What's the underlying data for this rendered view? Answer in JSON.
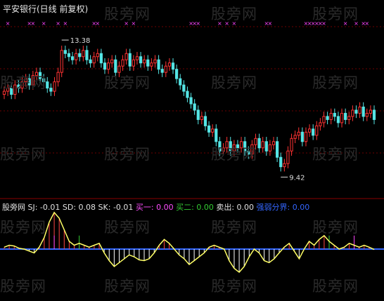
{
  "header": {
    "title": "平安银行(日线 前复权)",
    "watermark": "股旁网"
  },
  "indicator": {
    "name": "股旁网",
    "items": [
      {
        "label": "SJ:",
        "value": "-0.01",
        "color": "#e0e0e0"
      },
      {
        "label": "SD:",
        "value": "0.08",
        "color": "#e0e0e0"
      },
      {
        "label": "SK:",
        "value": "-0.01",
        "color": "#e0e0e0"
      },
      {
        "label": "买一:",
        "value": "0.00",
        "color": "#ff4dff",
        "value_color": "#ff4dff"
      },
      {
        "label": "买二:",
        "value": "0.00",
        "color": "#33cc33",
        "value_color": "#33cc33"
      },
      {
        "label": "卖出:",
        "value": "0.00",
        "color": "#e0e0e0",
        "value_color": "#e0e0e0"
      },
      {
        "label": "强弱分界:",
        "value": "0.00",
        "color": "#3366ff",
        "value_color": "#3366ff"
      }
    ]
  },
  "chart_data": [
    {
      "type": "candlestick",
      "title": "平安银行(日线 前复权)",
      "annotations": [
        {
          "text": "13.38",
          "kind": "high"
        },
        {
          "text": "9.42",
          "kind": "low"
        }
      ],
      "ylim": [
        8.6,
        14.4
      ],
      "colors": {
        "up": "#ff3333",
        "down": "#55e5e5",
        "marker": "#ff44ff"
      },
      "close": [
        11.9,
        12.0,
        11.8,
        12.1,
        12.0,
        12.2,
        12.3,
        12.1,
        12.4,
        12.5,
        12.3,
        12.2,
        12.0,
        11.9,
        12.2,
        12.5,
        13.2,
        13.1,
        13.0,
        12.9,
        13.1,
        13.0,
        13.2,
        12.9,
        12.8,
        13.0,
        13.1,
        12.8,
        12.6,
        12.8,
        12.9,
        12.5,
        12.7,
        12.9,
        13.1,
        12.7,
        12.9,
        13.0,
        12.8,
        12.9,
        12.7,
        12.8,
        12.9,
        12.6,
        12.5,
        12.7,
        12.8,
        12.6,
        12.3,
        12.1,
        11.9,
        11.7,
        11.5,
        11.3,
        11.0,
        11.1,
        10.8,
        10.6,
        10.7,
        10.3,
        10.0,
        10.1,
        10.3,
        10.0,
        10.2,
        10.1,
        10.3,
        10.0,
        9.9,
        10.2,
        10.4,
        10.1,
        10.3,
        10.0,
        10.2,
        10.3,
        9.8,
        9.5,
        9.6,
        10.0,
        10.4,
        10.5,
        10.6,
        10.3,
        10.6,
        10.7,
        10.5,
        10.8,
        10.9,
        11.1,
        11.0,
        11.2,
        11.1,
        10.9,
        11.2,
        11.0,
        11.1,
        11.3,
        11.2,
        11.4,
        11.1,
        11.2,
        11.3,
        11.0
      ],
      "markers_row": [
        0,
        1,
        0,
        0,
        0,
        0,
        0,
        1,
        1,
        0,
        0,
        1,
        0,
        0,
        0,
        1,
        0,
        1,
        0,
        0,
        0,
        0,
        0,
        0,
        0,
        1,
        1,
        0,
        0,
        0,
        0,
        0,
        0,
        0,
        1,
        0,
        1,
        0,
        0,
        0,
        0,
        0,
        0,
        0,
        0,
        0,
        0,
        0,
        0,
        0,
        0,
        0,
        1,
        1,
        1,
        0,
        0,
        0,
        0,
        0,
        1,
        0,
        1,
        0,
        1,
        0,
        0,
        0,
        0,
        0,
        0,
        0,
        0,
        1,
        1,
        0,
        0,
        0,
        0,
        0,
        0,
        0,
        0,
        0,
        1,
        1,
        1,
        1,
        1,
        1,
        0,
        0,
        0,
        0,
        0,
        1,
        0,
        0,
        1,
        0,
        1,
        1,
        0,
        0
      ]
    },
    {
      "type": "line",
      "title": "",
      "ylim": [
        -1,
        1
      ],
      "series": [
        {
          "name": "SJ",
          "values": [
            0.05,
            0.1,
            0.08,
            0.02,
            0.0,
            -0.05,
            -0.1,
            0.05,
            0.3,
            0.7,
            0.95,
            0.8,
            0.5,
            0.2,
            0.1,
            0.15,
            0.1,
            0.05,
            0.1,
            0.15,
            -0.1,
            -0.3,
            -0.45,
            -0.35,
            -0.25,
            -0.15,
            -0.2,
            -0.28,
            -0.3,
            -0.25,
            -0.1,
            0.1,
            0.25,
            0.15,
            0.0,
            -0.15,
            -0.25,
            -0.4,
            -0.3,
            -0.2,
            -0.1,
            0.05,
            0.1,
            0.05,
            0.0,
            -0.3,
            -0.5,
            -0.6,
            -0.45,
            -0.2,
            0.0,
            -0.1,
            -0.3,
            -0.35,
            -0.25,
            -0.1,
            0.05,
            0.15,
            -0.05,
            -0.25,
            0.0,
            0.2,
            0.1,
            0.25,
            0.35,
            0.2,
            0.1,
            0.0,
            0.05,
            0.15,
            0.1,
            0.05,
            0.1,
            0.05,
            -0.01
          ]
        }
      ]
    }
  ]
}
